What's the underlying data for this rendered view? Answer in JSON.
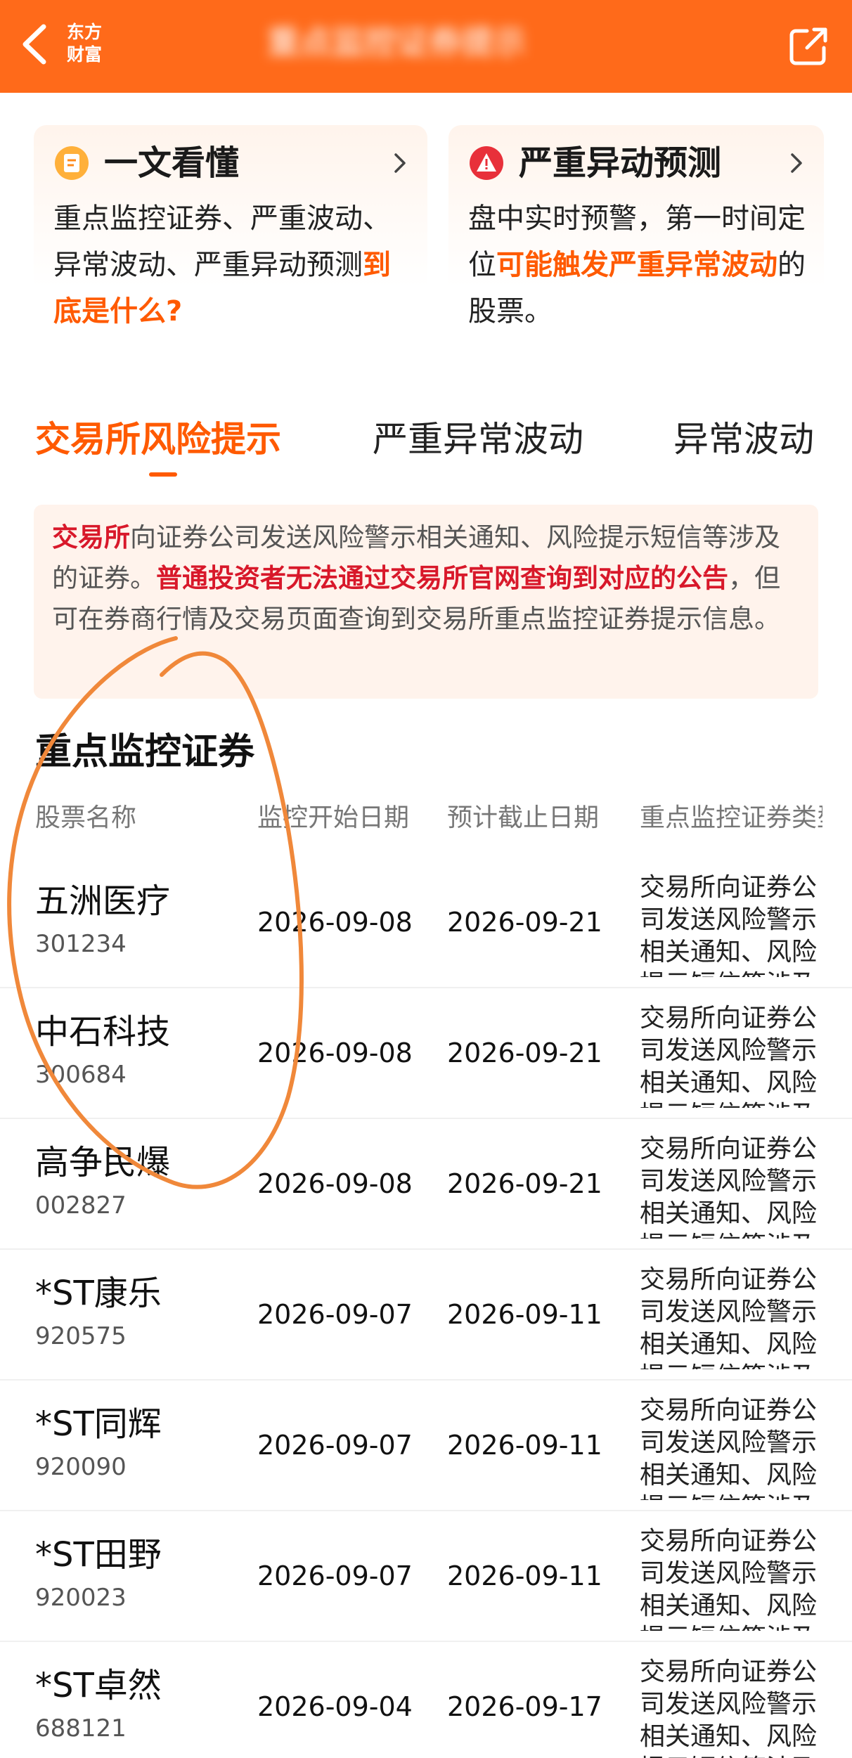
{
  "header": {
    "brand_line1": "东方",
    "brand_line2": "财富",
    "title": "重点监控证券提示"
  },
  "cards": {
    "left": {
      "title": "一文看懂",
      "body_plain": "重点监控证券、严重波动、异常波动、严重异动预测",
      "body_highlight": "到底是什么?"
    },
    "right": {
      "title": "严重异动预测",
      "body_prefix": "盘中实时预警，第一时间定位",
      "body_highlight": "可能触发严重异常波动",
      "body_suffix": "的股票。"
    }
  },
  "tabs": [
    {
      "label": "交易所风险提示",
      "active": true
    },
    {
      "label": "严重异常波动",
      "active": false
    },
    {
      "label": "异常波动",
      "active": false
    }
  ],
  "notice": {
    "part1_red": "交易所",
    "part2": "向证券公司发送风险警示相关通知、风险提示短信等涉及的证券。",
    "part3_red": "普通投资者无法通过交易所官网查询到对应的公告",
    "part4": "，但可在券商行情及交易页面查询到交易所重点监控证券提示信息。"
  },
  "section": {
    "title": "重点监控证券"
  },
  "table": {
    "headers": [
      "股票名称",
      "监控开始日期",
      "预计截止日期",
      "重点监控证券类型"
    ],
    "rows": [
      {
        "name": "五洲医疗",
        "code": "301234",
        "start": "2026-09-08",
        "end": "2026-09-21",
        "desc": "交易所向证券公司发送风险警示相关通知、风险提示短信等涉及的证券"
      },
      {
        "name": "中石科技",
        "code": "300684",
        "start": "2026-09-08",
        "end": "2026-09-21",
        "desc": "交易所向证券公司发送风险警示相关通知、风险提示短信等涉及的证券"
      },
      {
        "name": "高争民爆",
        "code": "002827",
        "start": "2026-09-08",
        "end": "2026-09-21",
        "desc": "交易所向证券公司发送风险警示相关通知、风险提示短信等涉及的证券"
      },
      {
        "name": "*ST康乐",
        "code": "920575",
        "start": "2026-09-07",
        "end": "2026-09-11",
        "desc": "交易所向证券公司发送风险警示相关通知、风险提示短信等涉及的证券"
      },
      {
        "name": "*ST同辉",
        "code": "920090",
        "start": "2026-09-07",
        "end": "2026-09-11",
        "desc": "交易所向证券公司发送风险警示相关通知、风险提示短信等涉及的证券"
      },
      {
        "name": "*ST田野",
        "code": "920023",
        "start": "2026-09-07",
        "end": "2026-09-11",
        "desc": "交易所向证券公司发送风险警示相关通知、风险提示短信等涉及的证券"
      },
      {
        "name": "*ST卓然",
        "code": "688121",
        "start": "2026-09-04",
        "end": "2026-09-17",
        "desc": "交易所向证券公司发送风险警示相关通知、风险提示短信等涉及的证券"
      }
    ]
  },
  "colors": {
    "header_bg": "#ff6a1a",
    "accent": "#ff5a00",
    "warning_red": "#d8182a",
    "annotation": "#f0883a"
  },
  "icons": {
    "back": "chevron-left-icon",
    "share": "share-icon",
    "doc": "document-icon",
    "alert": "alert-icon",
    "arrow": "chevron-right-icon"
  }
}
